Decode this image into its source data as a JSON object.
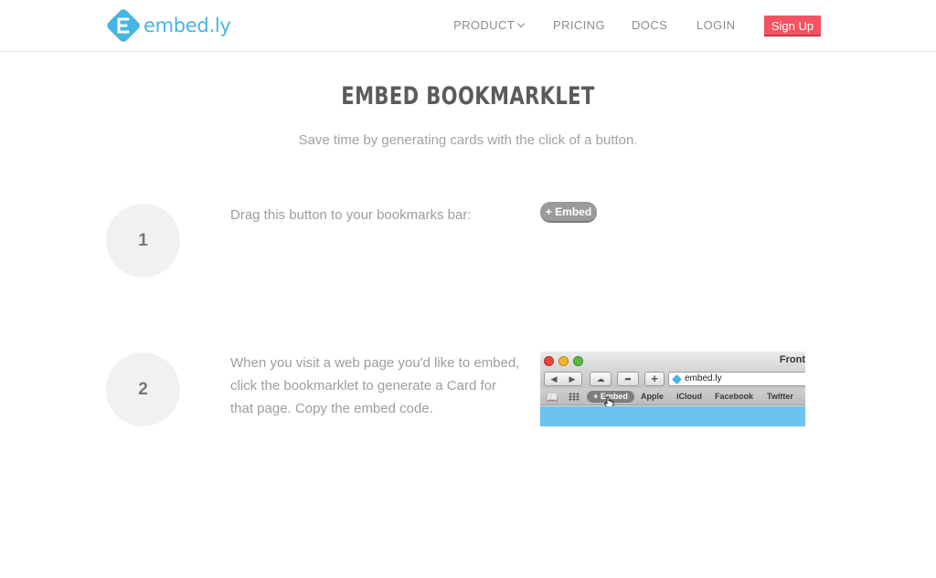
{
  "header": {
    "logo_text": "embed.ly",
    "nav": {
      "product": "PRODUCT",
      "pricing": "PRICING",
      "docs": "DOCS",
      "login": "LOGIN",
      "signup": "Sign Up"
    }
  },
  "main": {
    "title": "EMBED BOOKMARKLET",
    "subtitle": "Save time by generating cards with the click of a button."
  },
  "steps": [
    {
      "number": "1",
      "text": "Drag this button to your bookmarks bar:",
      "button_label": "+ Embed"
    },
    {
      "number": "2",
      "text": "When you visit a web page you'd like to embed, click the bookmarklet to generate a Card for that page. Copy the embed code."
    }
  ],
  "browser_screenshot": {
    "window_title": "Front",
    "url": "embed.ly",
    "bookmarks": [
      "+ Embed",
      "Apple",
      "iCloud",
      "Facebook",
      "Twitter"
    ]
  },
  "colors": {
    "brand": "#45b6e3",
    "signup": "#f45162",
    "page_bg": "#ffffff",
    "screenshot_content": "#6cc4ee"
  }
}
